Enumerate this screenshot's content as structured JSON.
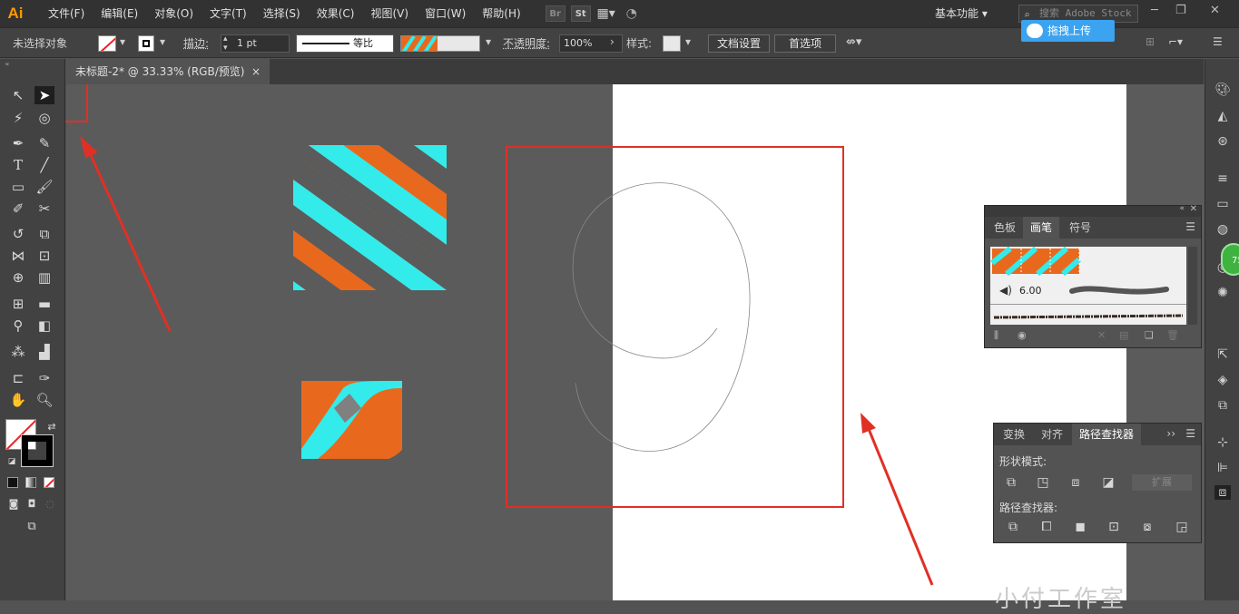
{
  "app": {
    "logo": "Ai"
  },
  "menu": [
    "文件(F)",
    "编辑(E)",
    "对象(O)",
    "文字(T)",
    "选择(S)",
    "效果(C)",
    "视图(V)",
    "窗口(W)",
    "帮助(H)"
  ],
  "menu_icons": {
    "br": "Br",
    "st": "St"
  },
  "workspace": "基本功能",
  "search_placeholder": "搜索 Adobe Stock",
  "upload_label": "拖拽上传",
  "control": {
    "no_selection": "未选择对象",
    "stroke_label": "描边:",
    "stroke_value": "1 pt",
    "stroke_style": "等比",
    "opacity_label": "不透明度:",
    "opacity_value": "100%",
    "style_label": "样式:",
    "doc_settings": "文档设置",
    "preferences": "首选项"
  },
  "document_tab": {
    "title": "未标题-2* @ 33.33% (RGB/预览)",
    "close": "×"
  },
  "brushes_panel": {
    "tabs": [
      "色板",
      "画笔",
      "符号"
    ],
    "active_tab": "画笔",
    "brush_size": "6.00"
  },
  "pathfinder_panel": {
    "tabs": [
      "变换",
      "对齐",
      "路径查找器"
    ],
    "active_tab": "路径查找器",
    "shape_modes_label": "形状模式:",
    "expand_label": "扩展",
    "pathfinders_label": "路径查找器:"
  },
  "badge": "75",
  "watermark": "小付工作室",
  "colors": {
    "orange": "#e8691d",
    "cyan": "#33ebeb",
    "annotation_red": "#e03025",
    "ui_dark": "#424242"
  }
}
